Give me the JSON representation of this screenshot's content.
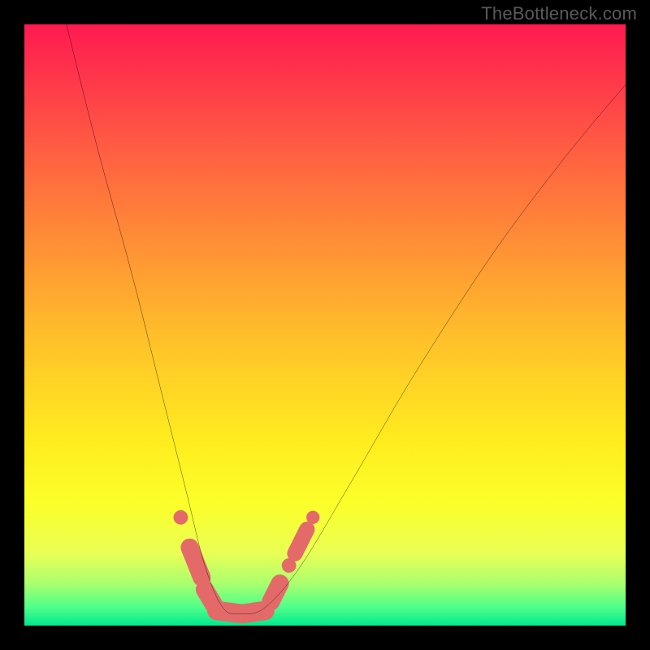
{
  "watermark": "TheBottleneck.com",
  "chart_data": {
    "type": "line",
    "title": "",
    "xlabel": "",
    "ylabel": "",
    "xlim": [
      0,
      100
    ],
    "ylim": [
      0,
      100
    ],
    "grid": false,
    "legend": false,
    "series": [
      {
        "name": "curve",
        "x": [
          7,
          12,
          18,
          23,
          27,
          30,
          33,
          36,
          40,
          46,
          55,
          65,
          78,
          90,
          100
        ],
        "values": [
          100,
          80,
          58,
          38,
          22,
          10,
          3,
          2,
          3,
          10,
          25,
          42,
          62,
          78,
          90
        ]
      }
    ],
    "markers": [
      {
        "name": "left-dot-1",
        "shape": "circle",
        "x": 26,
        "y": 18,
        "r": 1.2,
        "color": "#e46a6a"
      },
      {
        "name": "left-capsule-1",
        "shape": "capsule",
        "x1": 27.5,
        "y1": 13,
        "x2": 29.5,
        "y2": 8,
        "r": 1.5,
        "color": "#e46a6a"
      },
      {
        "name": "left-capsule-2",
        "shape": "capsule",
        "x1": 30,
        "y1": 6,
        "x2": 31.5,
        "y2": 3.5,
        "r": 1.5,
        "color": "#e46a6a"
      },
      {
        "name": "bottom-capsule-1",
        "shape": "capsule",
        "x1": 32,
        "y1": 2.5,
        "x2": 36,
        "y2": 2,
        "r": 1.6,
        "color": "#e46a6a"
      },
      {
        "name": "bottom-capsule-2",
        "shape": "capsule",
        "x1": 36.5,
        "y1": 2,
        "x2": 40,
        "y2": 2.5,
        "r": 1.6,
        "color": "#e46a6a"
      },
      {
        "name": "right-capsule-1",
        "shape": "capsule",
        "x1": 41,
        "y1": 4,
        "x2": 42.5,
        "y2": 7,
        "r": 1.5,
        "color": "#e46a6a"
      },
      {
        "name": "right-dot-1",
        "shape": "circle",
        "x": 44,
        "y": 10,
        "r": 1.2,
        "color": "#e46a6a"
      },
      {
        "name": "right-capsule-2",
        "shape": "capsule",
        "x1": 45,
        "y1": 12,
        "x2": 47,
        "y2": 16,
        "r": 1.3,
        "color": "#e46a6a"
      },
      {
        "name": "right-dot-2",
        "shape": "circle",
        "x": 48,
        "y": 18,
        "r": 1.1,
        "color": "#e46a6a"
      }
    ],
    "gradient_stops": [
      {
        "pos": 0,
        "color": "#ff1a51"
      },
      {
        "pos": 10,
        "color": "#ff3a4a"
      },
      {
        "pos": 25,
        "color": "#ff6b3f"
      },
      {
        "pos": 40,
        "color": "#ff9a33"
      },
      {
        "pos": 55,
        "color": "#ffc828"
      },
      {
        "pos": 70,
        "color": "#ffee1f"
      },
      {
        "pos": 80,
        "color": "#fbff2a"
      },
      {
        "pos": 88,
        "color": "#e9ff55"
      },
      {
        "pos": 93,
        "color": "#aaff6e"
      },
      {
        "pos": 97,
        "color": "#4dff8a"
      },
      {
        "pos": 100,
        "color": "#00e88e"
      }
    ]
  }
}
